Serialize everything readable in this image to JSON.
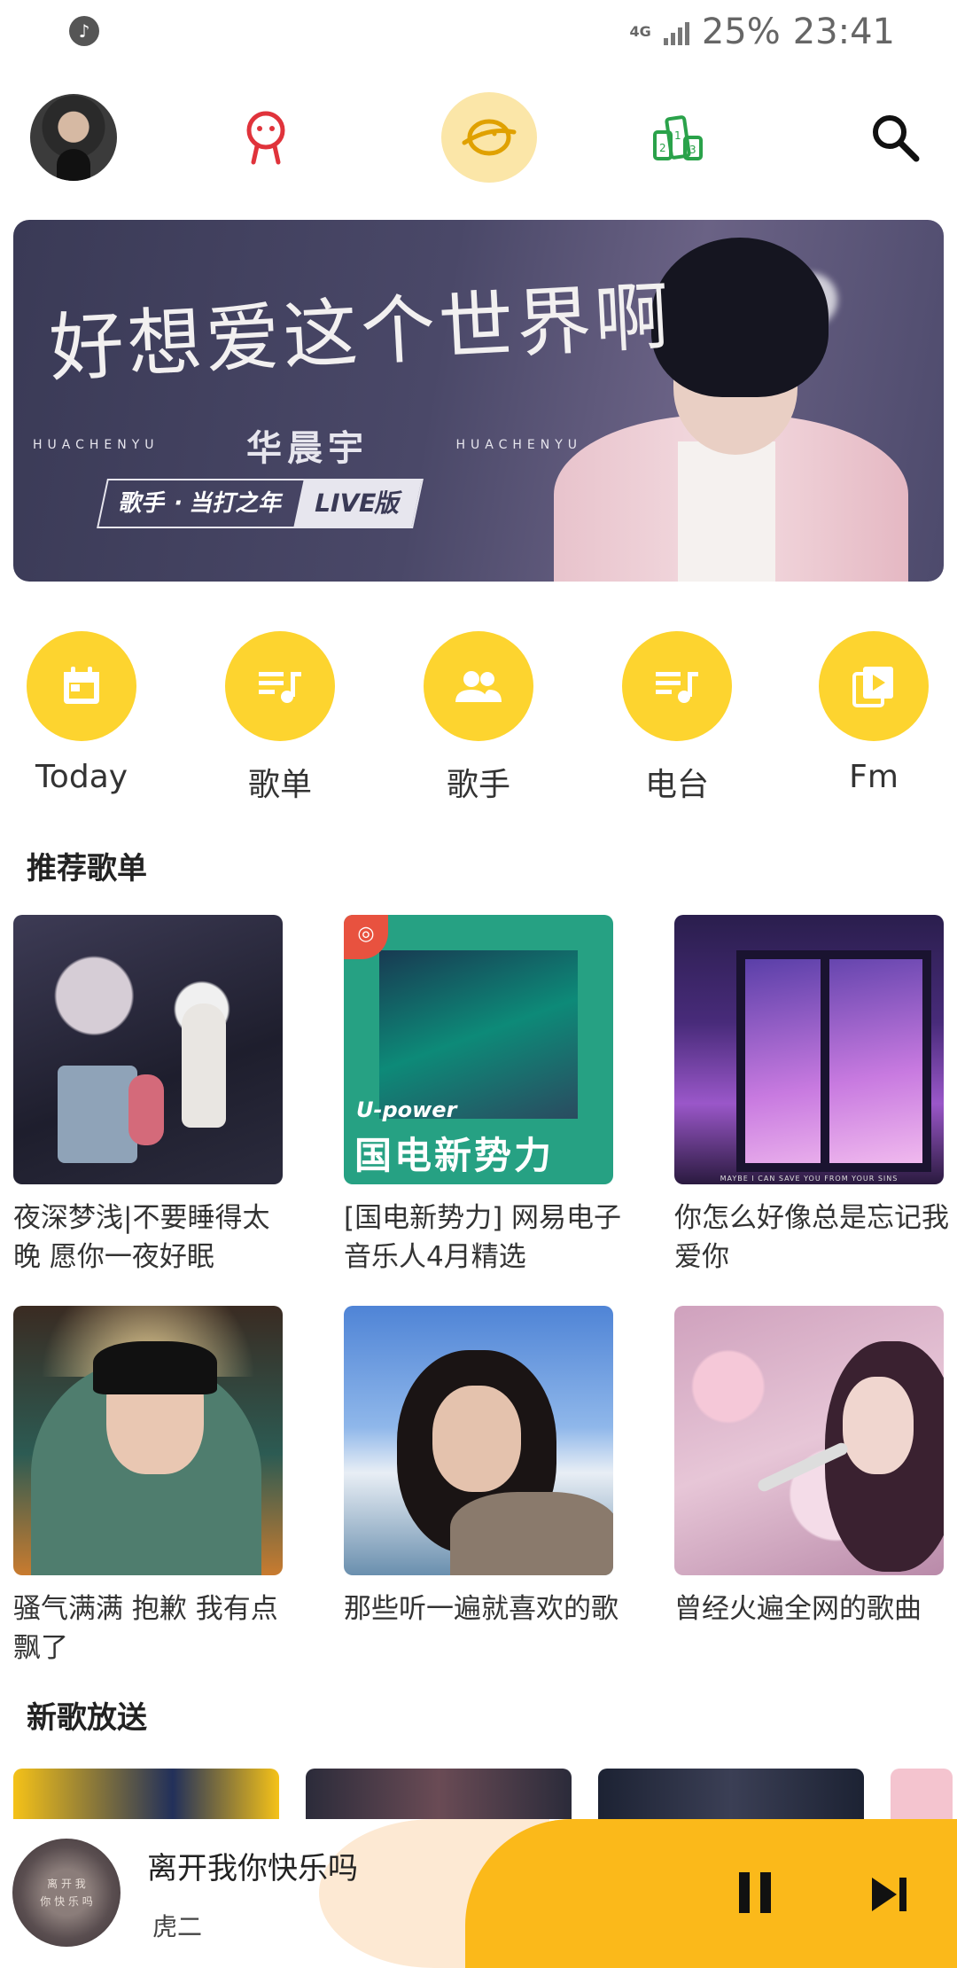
{
  "status_bar": {
    "network": "4G",
    "battery": "25%",
    "time": "23:41"
  },
  "top_nav": {
    "icons": [
      "avatar",
      "user-icon",
      "discover-planet-icon",
      "chart-podium-icon",
      "search-icon"
    ],
    "active": "discover"
  },
  "banner": {
    "title": "好想爱这个世界啊",
    "artist": "华晨宇",
    "artist_roman": "HUACHENYU",
    "tag_left": "歌手 · 当打之年",
    "tag_right": "LIVE版"
  },
  "categories": [
    {
      "label": "Today",
      "icon": "calendar-icon"
    },
    {
      "label": "歌单",
      "icon": "playlist-icon"
    },
    {
      "label": "歌手",
      "icon": "singers-icon"
    },
    {
      "label": "电台",
      "icon": "radio-playlist-icon"
    },
    {
      "label": "Fm",
      "icon": "fm-play-icon"
    }
  ],
  "sections": {
    "recommended_title": "推荐歌单",
    "new_songs_title": "新歌放送"
  },
  "playlists": [
    {
      "name": "夜深梦浅|不要睡得太晚 愿你一夜好眠"
    },
    {
      "name": "[国电新势力] 网易电子音乐人4月精选",
      "cover_text_1": "U-power",
      "cover_text_2": "国电新势力"
    },
    {
      "name": "你怎么好像总是忘记我爱你",
      "cover_caption": "MAYBE I CAN SAVE YOU FROM YOUR SINS"
    },
    {
      "name": "骚气满满 抱歉 我有点飘了"
    },
    {
      "name": "那些听一遍就喜欢的歌"
    },
    {
      "name": "曾经火遍全网的歌曲"
    }
  ],
  "player": {
    "title": "离开我你快乐吗",
    "artist": "虎二",
    "art_text": "离 开 我\n你 快 乐 吗",
    "state": "playing"
  },
  "colors": {
    "accent_yellow": "#fdd42f",
    "player_yellow": "#fbb91a",
    "discover_bg": "#fbe6a8",
    "user_icon": "#e0333b",
    "chart_icon": "#2aa24a"
  }
}
